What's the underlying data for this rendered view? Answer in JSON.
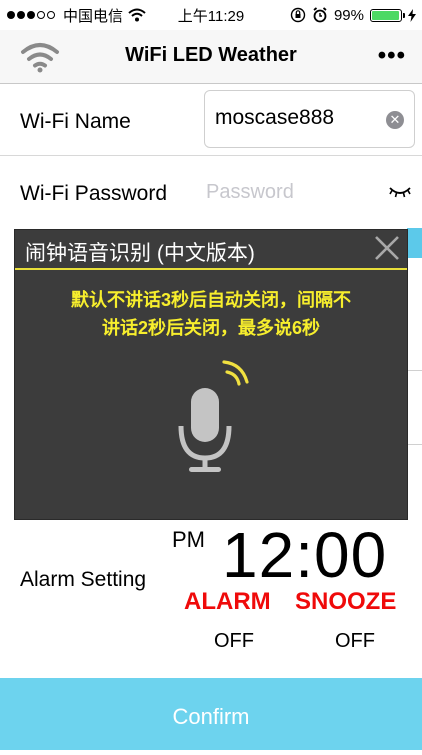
{
  "status_bar": {
    "carrier": "中国电信",
    "time": "上午11:29",
    "battery": "99%"
  },
  "nav": {
    "title": "WiFi LED Weather",
    "more": "•••",
    "left_icon": "wifi-icon"
  },
  "wifi_name": {
    "label": "Wi-Fi Name",
    "value": "moscase888"
  },
  "wifi_password": {
    "label": "Wi-Fi Password",
    "placeholder": "Password"
  },
  "dialog": {
    "title": "闹钟语音识别 (中文版本)",
    "message_line1": "默认不讲话3秒后自动关闭，间隔不",
    "message_line2": "讲话2秒后关闭，最多说6秒",
    "icon": "microphone-icon",
    "accent_color": "#f7ee2d"
  },
  "alarm": {
    "label": "Alarm Setting",
    "ampm": "PM",
    "time": "12:00",
    "alarm_button": "ALARM",
    "snooze_button": "SNOOZE",
    "alarm_state": "OFF",
    "snooze_state": "OFF",
    "button_color": "#ef0a0a"
  },
  "confirm": {
    "label": "Confirm",
    "color": "#6dd3ee"
  }
}
